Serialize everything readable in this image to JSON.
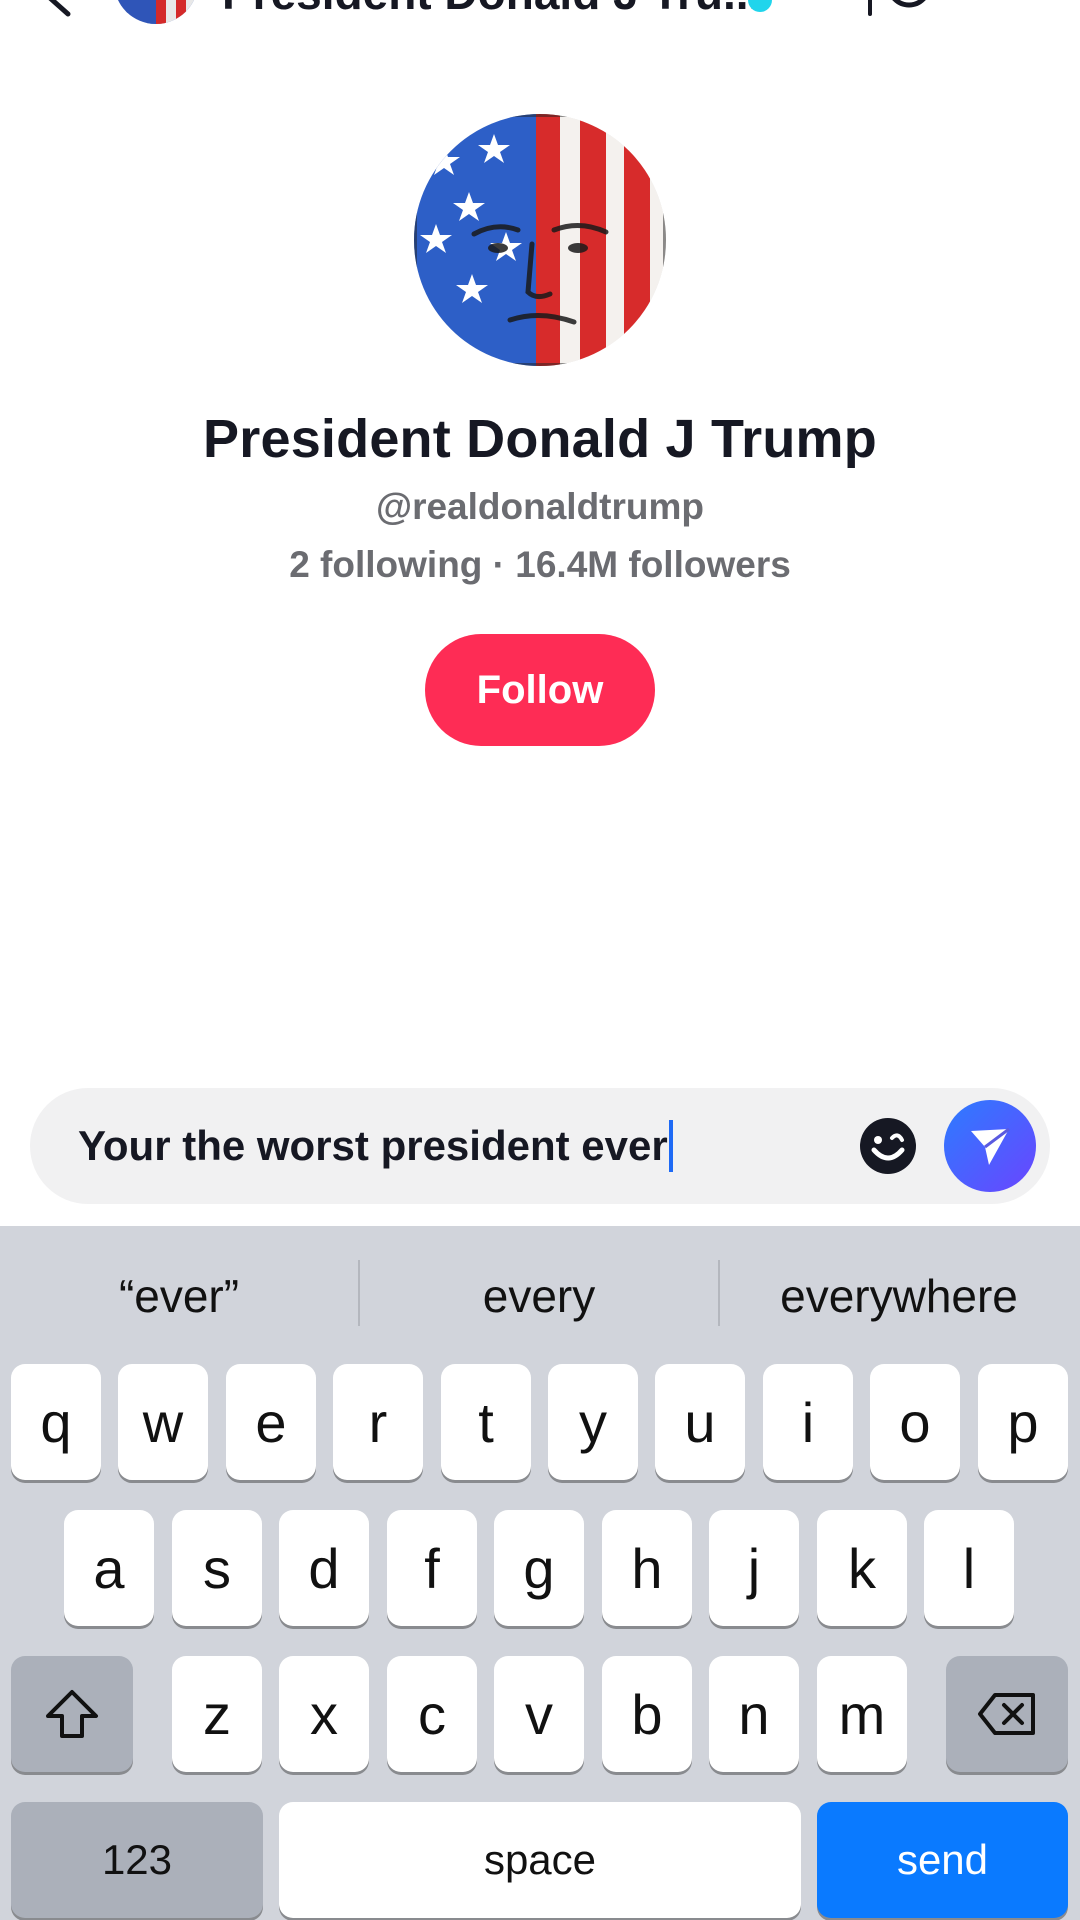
{
  "header": {
    "title": "President Donald J Tru..."
  },
  "profile": {
    "name": "President Donald J Trump",
    "handle": "@realdonaldtrump",
    "stats": "2 following · 16.4M followers",
    "follow_label": "Follow"
  },
  "composer": {
    "message": "Your the worst president ever"
  },
  "keyboard": {
    "suggestions": [
      "“ever”",
      "every",
      "everywhere"
    ],
    "row1": [
      "q",
      "w",
      "e",
      "r",
      "t",
      "y",
      "u",
      "i",
      "o",
      "p"
    ],
    "row2": [
      "a",
      "s",
      "d",
      "f",
      "g",
      "h",
      "j",
      "k",
      "l"
    ],
    "row3": [
      "z",
      "x",
      "c",
      "v",
      "b",
      "n",
      "m"
    ],
    "numbers_label": "123",
    "space_label": "space",
    "send_label": "send"
  },
  "colors": {
    "follow": "#fe2c55",
    "send_key": "#0a7aff",
    "verified": "#20d5ec",
    "keyboard_bg": "#d1d4db"
  }
}
